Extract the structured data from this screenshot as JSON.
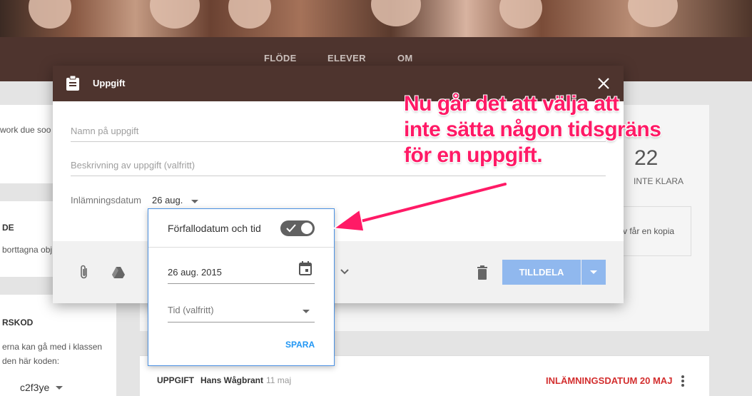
{
  "nav": {
    "tabs": [
      "FLÖDE",
      "ELEVER",
      "OM"
    ]
  },
  "background": {
    "left_snippet_1": "work due soo",
    "left_heading_2": "DE",
    "left_snippet_2": "borttagna obj",
    "left_heading_3": "RSKOD",
    "left_snippet_3a": "erna kan gå med i klassen",
    "left_snippet_3b": "den här koden:",
    "class_code": "c2f3ye",
    "stat_number": "22",
    "stat_label": "INTE KLARA",
    "copy_snippet": "v får en kopia",
    "post": {
      "type": "UPPGIFT",
      "author": "Hans Wågbrant",
      "date": "11 maj",
      "due": "INLÄMNINGSDATUM 20 MAJ"
    }
  },
  "dialog": {
    "title": "Uppgift",
    "name_placeholder": "Namn på uppgift",
    "description_placeholder": "Beskrivning av uppgift (valfritt)",
    "due_label": "Inlämningsdatum",
    "due_value": "26 aug.",
    "assign_label": "TILLDELA"
  },
  "popover": {
    "toggle_label": "Förfallodatum och tid",
    "toggle_on": true,
    "date_value": "26 aug. 2015",
    "time_placeholder": "Tid (valfritt)",
    "save_label": "SPARA"
  },
  "annotation": {
    "line1": "Nu går det att välja att",
    "line2": "inte sätta någon tidsgräns",
    "line3": "för en uppgift."
  },
  "colors": {
    "header": "#4e342e",
    "accent": "#ff1a66",
    "primary": "#90b8ee",
    "link": "#2196f3"
  }
}
